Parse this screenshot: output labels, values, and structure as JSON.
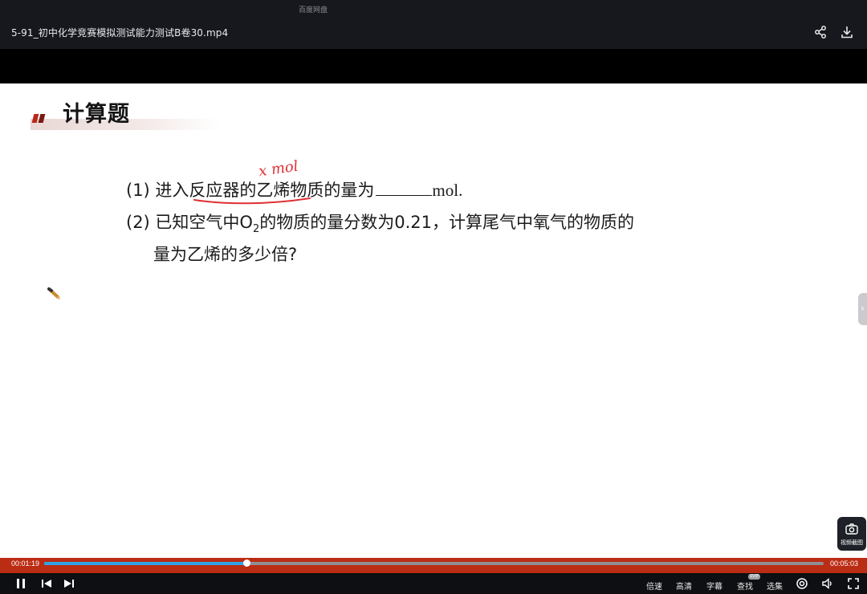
{
  "window": {
    "app_name": "百度网盘",
    "video_title": "5-91_初中化学竞赛模拟测试能力测试B卷30.mp4",
    "icons": [
      "share-icon",
      "download-icon"
    ]
  },
  "slide": {
    "heading": "计算题",
    "q1_prefix": "(1) 进入反应器的乙烯物质的量为",
    "q1_unit": "mol.",
    "q2_line1_a": "(2) 已知空气中O",
    "q2_line1_sub": "2",
    "q2_line1_b": "的物质的量分数为0.21，计算尾气中氧气的物质的",
    "q2_line2": "量为乙烯的多少倍?",
    "handwritten_note": "x mol",
    "annotation_color": "#e02e33"
  },
  "screenshot_button": {
    "label": "视频截图"
  },
  "player": {
    "current_time": "00:01:19",
    "total_time": "00:05:03",
    "progress_fraction": 0.26,
    "accent_color": "#2fa5e8",
    "controls": {
      "speed": "倍速",
      "quality": "高清",
      "subtitle": "字幕",
      "search": "查找",
      "search_badge": "SVIP",
      "episodes": "选集"
    }
  }
}
